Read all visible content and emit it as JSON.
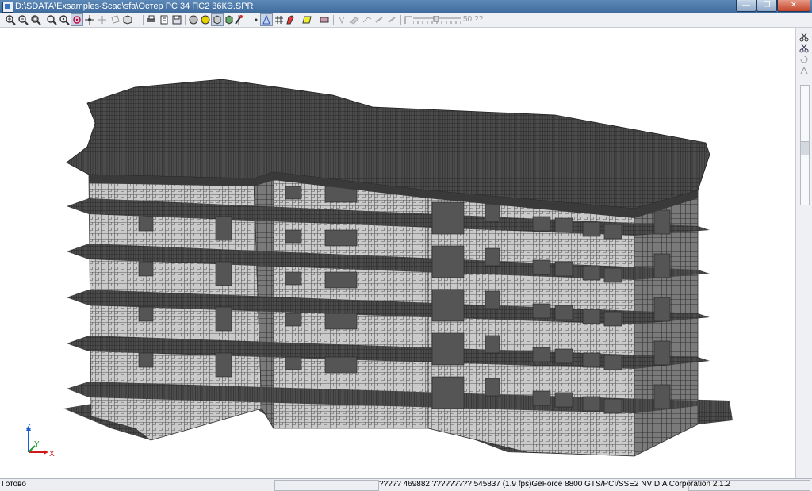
{
  "window": {
    "title": "D:\\SDATA\\Exsamples-Scad\\sfa\\Остер РС 34 ПС2 36КЭ.SPR",
    "controls": [
      "minimize",
      "maximize",
      "close"
    ]
  },
  "toolbar": {
    "buttons": [
      "zoom-in-icon",
      "zoom-out-icon",
      "zoom-window-icon",
      "zoom-prev-icon",
      "zoom-fit-icon",
      "pan-icon",
      "rotate-icon",
      "fit-all-icon",
      "select-icon",
      "view-3d-icon",
      "print-icon",
      "print-preview-icon",
      "save-image-icon",
      "shading-icon",
      "color-fill-icon",
      "cube-icon",
      "cube-solid-icon",
      "magic-icon",
      "pointer-icon",
      "axes-icon",
      "grid-icon",
      "pencil-icon",
      "paint-icon",
      "layers-icon",
      "filter-icon",
      "erase-icon",
      "measure-icon"
    ],
    "zoom_value": "50 ??"
  },
  "sidebar": {
    "buttons": [
      "scissors-icon",
      "scissors-alt-icon",
      "restore-icon",
      "filter-icon"
    ]
  },
  "axes": {
    "z": "Z",
    "y": "Y",
    "x": "X"
  },
  "status": {
    "left": "Готово",
    "right": "????? 469882  ????????? 545837  (1.9 fps)GeForce 8800 GTS/PCI/SSE2 NVIDIA Corporation 2.1.2"
  },
  "colors": {
    "title_bar": "#3e6a9c",
    "mesh_wall": "#c9c9c9",
    "mesh_slab": "#4a4a4a",
    "mesh_line": "#2b2b2b",
    "axis_z": "#1a5fd0",
    "axis_y": "#1a9a2a",
    "axis_x": "#d01a1a"
  }
}
